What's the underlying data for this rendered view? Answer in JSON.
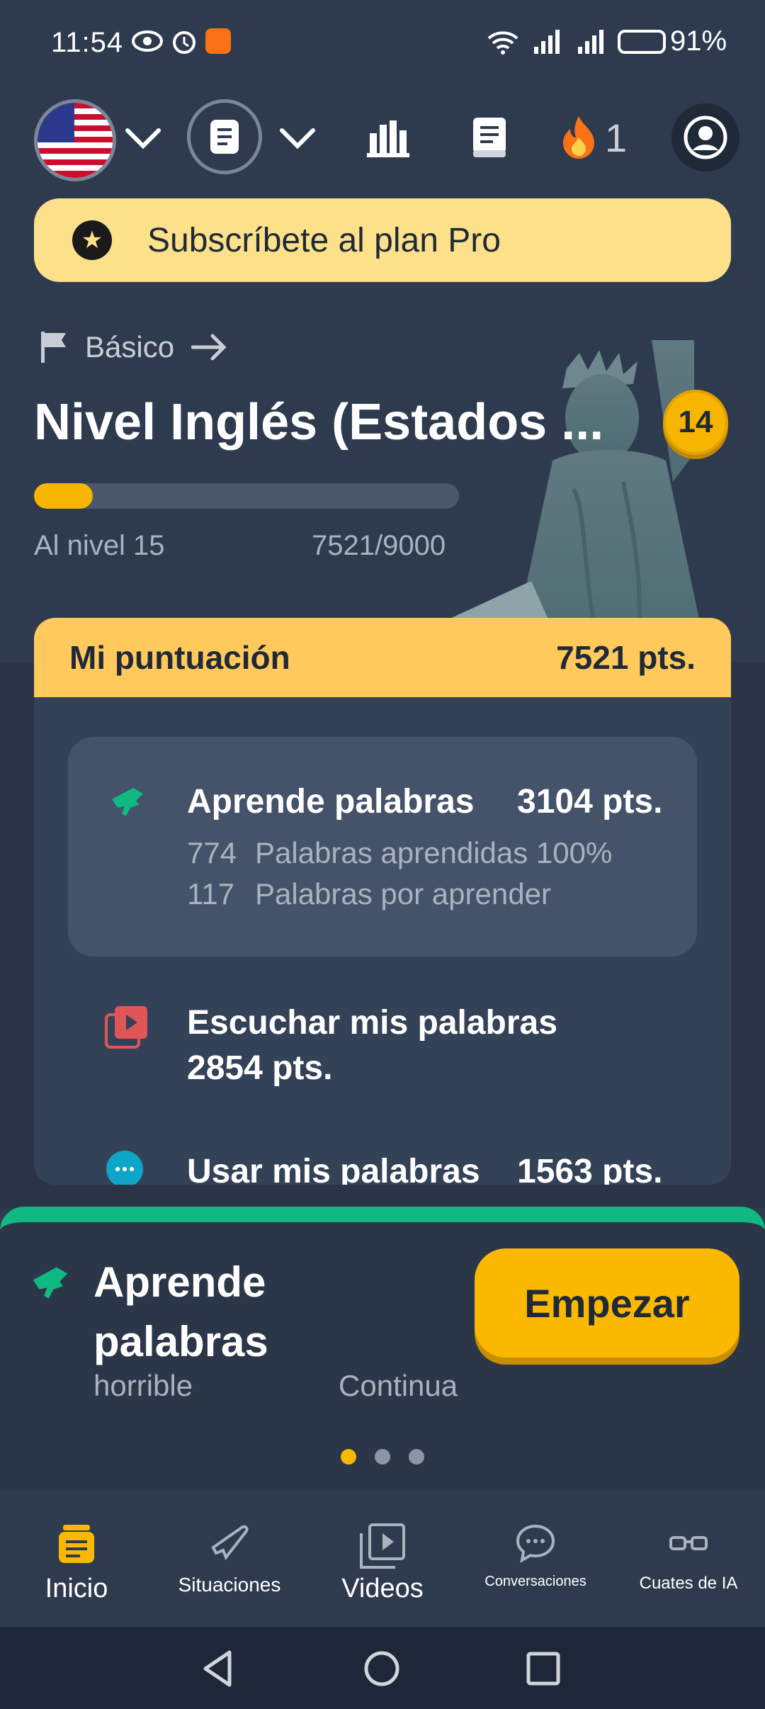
{
  "status_bar": {
    "time": "11:54",
    "battery": "91%"
  },
  "top_nav": {
    "streak_count": "1"
  },
  "pro_banner": {
    "label": "Subscríbete al plan Pro"
  },
  "level": {
    "tier_label": "Básico",
    "title": "Nivel Inglés (Estados ...",
    "badge_number": "14",
    "progress_fraction": 0.1389,
    "next_level_label": "Al nivel 15",
    "progress_text": "7521/9000"
  },
  "score": {
    "header_label": "Mi puntuación",
    "header_value": "7521 pts.",
    "activities": [
      {
        "title": "Aprende palabras",
        "points": "3104 pts.",
        "line1_num": "774",
        "line1_text": "Palabras aprendidas 100%",
        "line2_num": "117",
        "line2_text": "Palabras por aprender"
      },
      {
        "title": "Escuchar mis palabras",
        "points": "2854 pts."
      },
      {
        "title": "Usar mis palabras",
        "points": "1563 pts."
      }
    ]
  },
  "sheet": {
    "title": "Aprende palabras",
    "word1": "horrible",
    "word2": "Continua",
    "start_label": "Empezar"
  },
  "bottom_nav": {
    "items": [
      {
        "label": "Inicio"
      },
      {
        "label": "Situaciones"
      },
      {
        "label": "Videos"
      },
      {
        "label": "Conversaciones"
      },
      {
        "label": "Cuates de IA"
      }
    ]
  },
  "colors": {
    "accent": "#fbb800",
    "green": "#10b981",
    "background": "#2e3b4f"
  }
}
